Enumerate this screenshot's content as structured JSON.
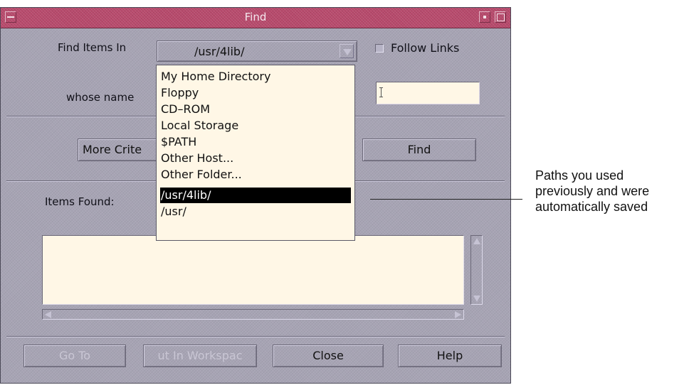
{
  "window": {
    "title": "Find"
  },
  "find_in": {
    "label": "Find Items In",
    "value": "/usr/4lib/",
    "options": [
      "My Home Directory",
      "Floppy",
      "CD–ROM",
      "Local Storage",
      "$PATH",
      "Other Host...",
      "Other Folder...",
      "/usr/4lib/",
      "/usr/"
    ],
    "selected_index": 7
  },
  "follow_links": {
    "label": "Follow Links",
    "checked": false
  },
  "whose_name": {
    "label": "whose name",
    "value": ""
  },
  "buttons": {
    "more_criteria": "More Crite",
    "find": "Find",
    "go_to": "Go To",
    "put_in_workspace": "ut In Workspac",
    "close": "Close",
    "help": "Help"
  },
  "results": {
    "label": "Items Found:"
  },
  "callout": {
    "lines": [
      "Paths you used",
      "previously and were",
      "automatically saved"
    ]
  },
  "colors": {
    "titlebar": "#b84a6c",
    "dialog_bg": "#a7a4b4",
    "field_bg": "#fff7e6",
    "selection": "#000000"
  }
}
